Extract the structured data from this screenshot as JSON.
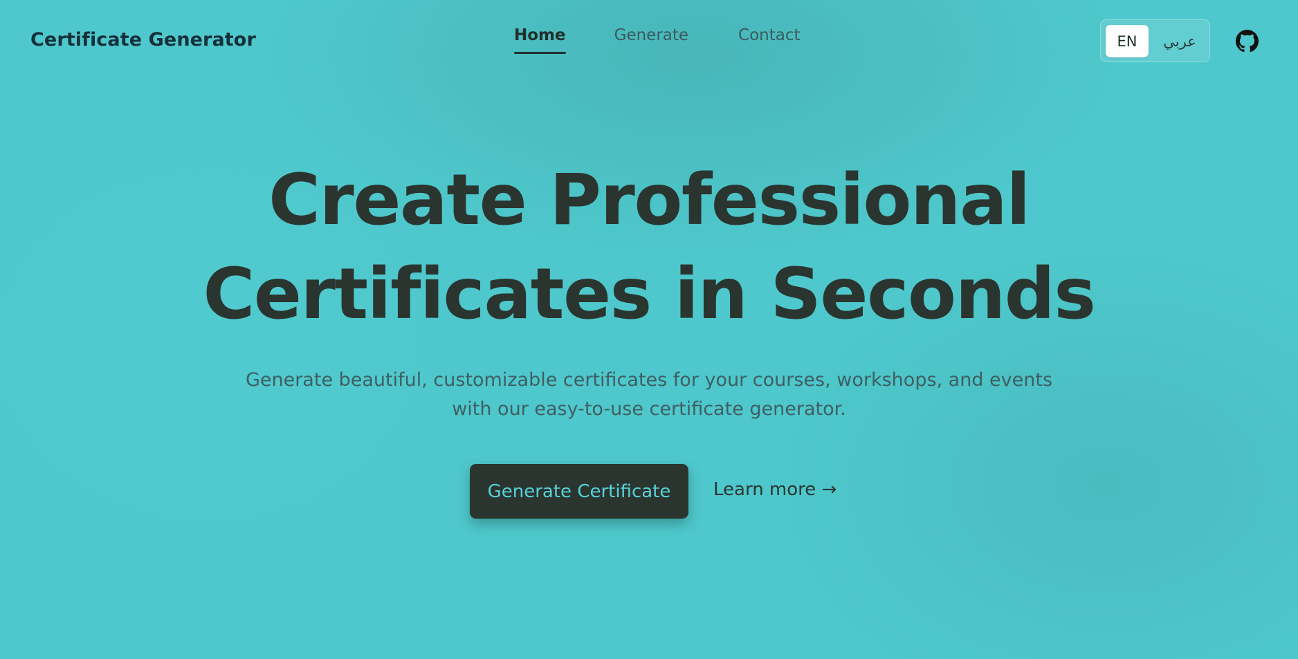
{
  "brand": {
    "name": "Certificate Generator"
  },
  "nav": {
    "links": [
      {
        "label": "Home",
        "active": true
      },
      {
        "label": "Generate",
        "active": false
      },
      {
        "label": "Contact",
        "active": false
      }
    ]
  },
  "language": {
    "options": [
      "EN",
      "عربي"
    ],
    "selected": "EN"
  },
  "icons": {
    "github": "github-icon"
  },
  "hero": {
    "title_line1": "Create Professional",
    "title_line2": "Certificates in Seconds",
    "subtitle_line1": "Generate beautiful, customizable certificates for your courses, workshops, and events",
    "subtitle_line2": "with our easy-to-use certificate generator.",
    "primary_cta": "Generate Certificate",
    "secondary_cta": "Learn more →"
  },
  "colors": {
    "background": "#4ec8cc",
    "primary_button": "#2b3530",
    "primary_button_text": "#56d4d8",
    "heading": "#2b3530"
  }
}
